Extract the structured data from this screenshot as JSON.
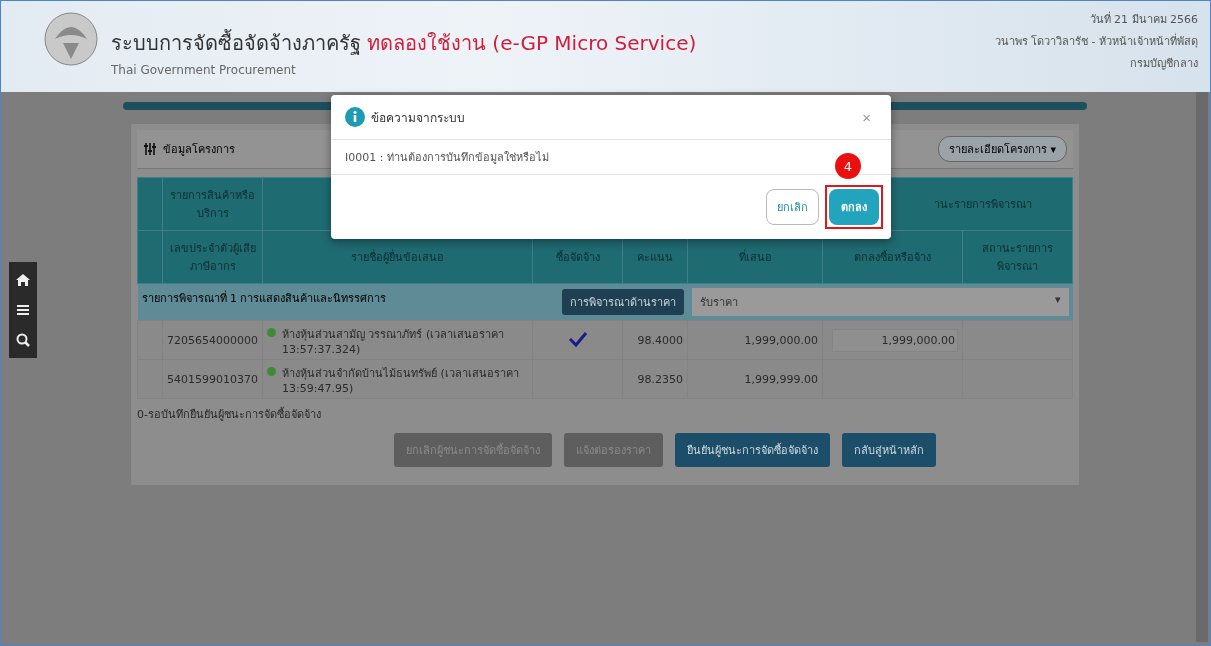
{
  "header": {
    "title": "ระบบการจัดซื้อจัดจ้างภาครัฐ",
    "title_highlight": "ทดลองใช้งาน (e-GP Micro Service)",
    "subtitle": "Thai Government Procurement",
    "date": "วันที่ 21 มีนาคม 2566",
    "user": "วนาพร โดวาวิลารัช - หัวหน้าเจ้าหน้าที่พัสดุ",
    "department": "กรมบัญชีกลาง"
  },
  "panel": {
    "title": "ข้อมูลโครงการ",
    "details_button": "รายละเอียดโครงการ",
    "details_caret": "▾"
  },
  "table": {
    "header_row_1": [
      {
        "label": "รายการสินค้าหรือบริการ"
      },
      {
        "label": "านะรายการพิจารณา"
      }
    ],
    "columns": [
      "เลขประจำตัวผู้เสียภาษีอากร",
      "รายชื่อผู้ยื่นข้อเสนอ",
      "ซื้อจัดจ้าง",
      "คะแนน",
      "ที่เสนอ",
      "ตกลงซื้อหรือจ้าง",
      "สถานะรายการพิจารณา"
    ],
    "group": {
      "label": "รายการพิจารณาที่ 1 การแสดงสินค้าและนิทรรศการ",
      "button": "การพิจารณาด้านราคา",
      "select_value": "รับราคา",
      "select_caret": "▾"
    },
    "rows": [
      {
        "tax_id": "7205654000000",
        "name": "ห้างหุ้นส่วนสามัญ วรรณาภัทร์ (เวลาเสนอราคา 13:57:37.324)",
        "winner": true,
        "score": "98.4000",
        "price": "1,999,000.00",
        "agreed_price": "1,999,000.00"
      },
      {
        "tax_id": "5401599010370",
        "name": "ห้างหุ้นส่วนจำกัดบ้านไม้ธนทรัพย์ (เวลาเสนอราคา 13:59:47.95)",
        "winner": false,
        "score": "98.2350",
        "price": "1,999,999.00"
      }
    ]
  },
  "note": "0-รอบันทึกยืนยันผู้ชนะการจัดซื้อจัดจ้าง",
  "buttons": [
    {
      "label": "ยกเลิกผู้ชนะการจัดซื้อจัดจ้าง",
      "disabled": true
    },
    {
      "label": "แจ้งต่อรองราคา",
      "disabled": true
    },
    {
      "label": "ยืนยันผู้ชนะการจัดซื้อจัดจ้าง",
      "disabled": false
    },
    {
      "label": "กลับสู่หน้าหลัก",
      "disabled": false
    }
  ],
  "dialog": {
    "title": "ข้อความจากระบบ",
    "close": "×",
    "message": "I0001 : ท่านต้องการบันทึกข้อมูลใช่หรือไม่",
    "cancel": "ยกเลิก",
    "ok": "ตกลง",
    "step": "4"
  }
}
